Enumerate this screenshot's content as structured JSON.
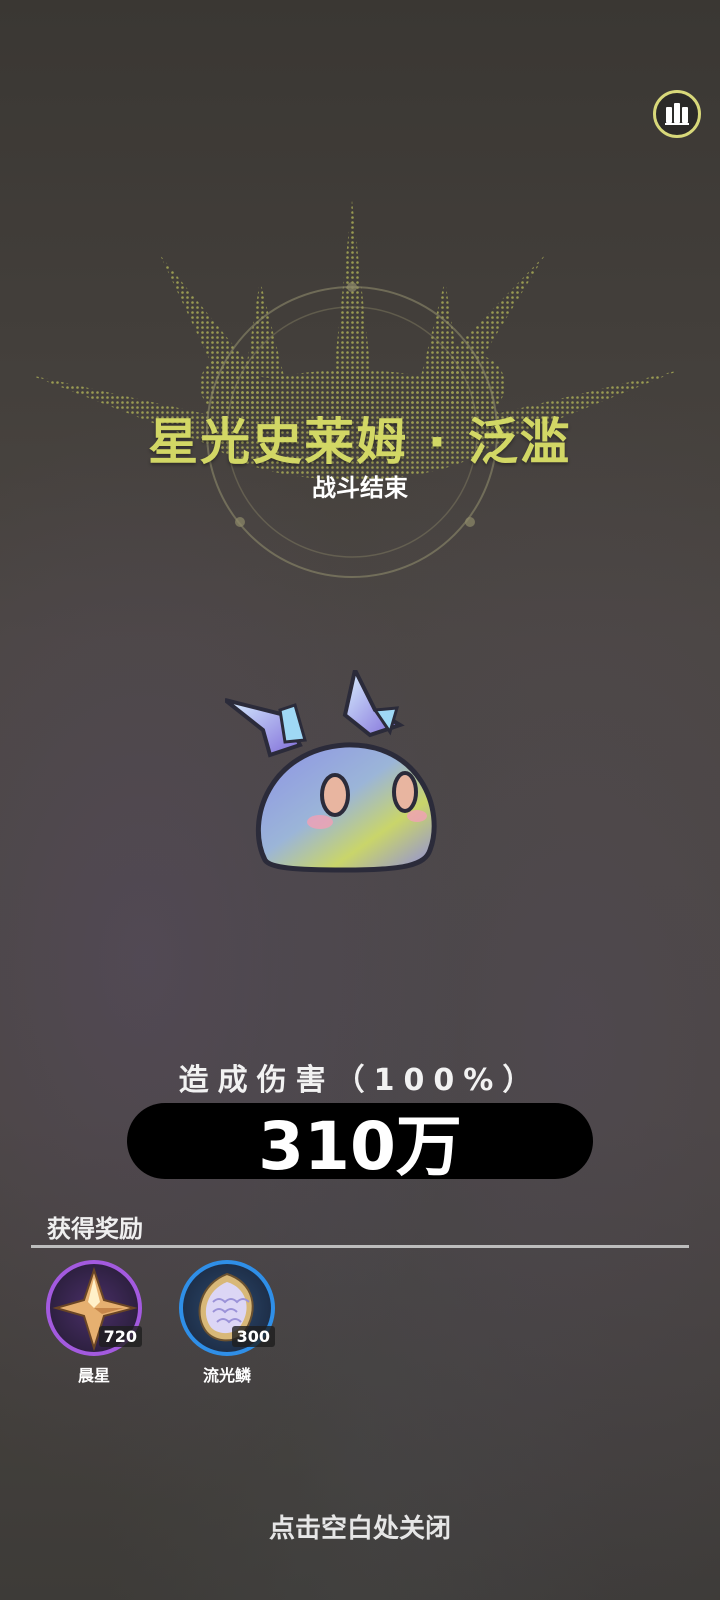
{
  "header": {
    "title": "星光史莱姆 · 泛滥",
    "subtitle": "战斗结束",
    "stats_icon": "bar-chart-icon"
  },
  "damage": {
    "label": "造成伤害（100%）",
    "value": "310万"
  },
  "rewards": {
    "title": "获得奖励",
    "items": [
      {
        "name": "晨星",
        "count": "720",
        "icon": "star-crystal-icon",
        "ring_color": "#a35adf"
      },
      {
        "name": "流光鳞",
        "count": "300",
        "icon": "shimmer-scale-icon",
        "ring_color": "#2f8fe8"
      }
    ]
  },
  "footer": {
    "close_hint": "点击空白处关闭"
  },
  "colors": {
    "title": "#d2d765",
    "damage_bar": "#000000",
    "stats_ring": "#d8d87a"
  }
}
